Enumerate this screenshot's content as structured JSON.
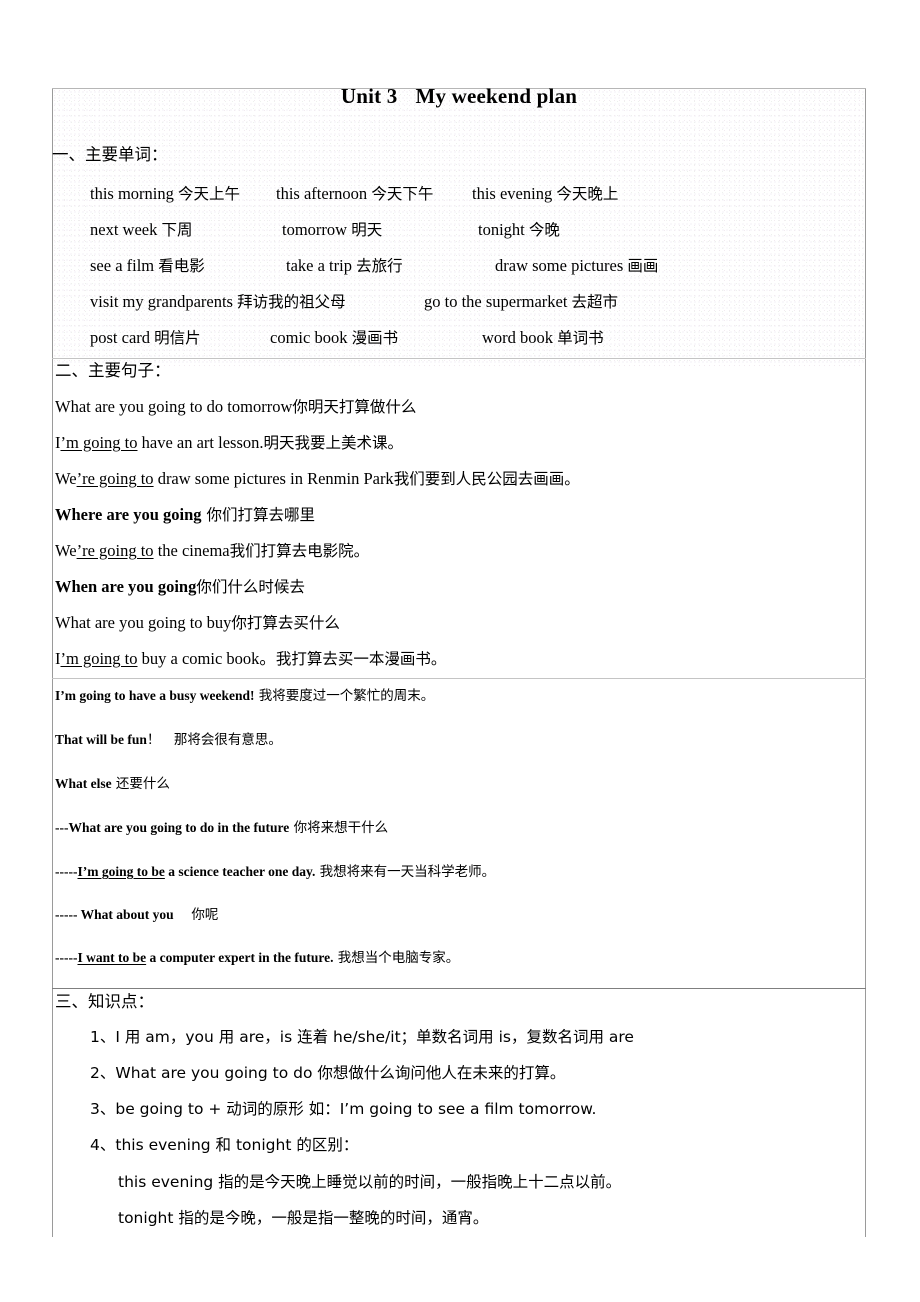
{
  "document": {
    "title_main": "Unit 3",
    "title_sub": "My weekend plan"
  },
  "section1": {
    "heading": "一、主要单词：",
    "rows": [
      [
        {
          "en": "this morning ",
          "cn": "今天上午"
        },
        {
          "en": "this afternoon ",
          "cn": "今天下午"
        },
        {
          "en": "this evening ",
          "cn": "今天晚上"
        }
      ],
      [
        {
          "en": "next week ",
          "cn": "下周"
        },
        {
          "en": "tomorrow ",
          "cn": "明天"
        },
        {
          "en": "tonight ",
          "cn": "今晚"
        }
      ],
      [
        {
          "en": "see a film ",
          "cn": "看电影"
        },
        {
          "en": "take a trip ",
          "cn": "去旅行"
        },
        {
          "en": "draw some pictures ",
          "cn": "画画"
        }
      ],
      [
        {
          "en": "visit my grandparents ",
          "cn": "拜访我的祖父母"
        },
        {
          "en": "go to the supermarket ",
          "cn": "去超市"
        }
      ],
      [
        {
          "en": "post card ",
          "cn": "明信片"
        },
        {
          "en": "comic book ",
          "cn": "漫画书"
        },
        {
          "en": "word book ",
          "cn": "单词书"
        }
      ]
    ]
  },
  "section2": {
    "heading": "二、主要句子：",
    "sentences": [
      {
        "plain": "What are you going to do tomorrow",
        "cn": "你明天打算做什么"
      },
      {
        "pre": "I",
        "underline": "’m going to",
        "post": " have an art lesson.",
        "cn": "明天我要上美术课。"
      },
      {
        "pre": "We",
        "underline": "’re going to",
        "post": " draw some pictures in Renmin Park",
        "cn": "我们要到人民公园去画画。"
      },
      {
        "bold": "Where are you going",
        "cn": " 你们打算去哪里"
      },
      {
        "pre": "We",
        "underline": "’re going to",
        "post": " the cinema",
        "cn": "我们打算去电影院。"
      },
      {
        "bold": "When are you going",
        "cn": "你们什么时候去"
      },
      {
        "plain": "What are you going to buy",
        "cn": "你打算去买什么"
      },
      {
        "pre": "I",
        "underline": "’m going to",
        "post": " buy a comic book。",
        "cn": "我打算去买一本漫画书。"
      }
    ],
    "bold_sentences": [
      {
        "lead": "",
        "bold": "I’m going to have a busy weekend!",
        "cn": " 我将要度过一个繁忙的周末。"
      },
      {
        "lead": "",
        "bold": "That will be fun",
        "bold_tail": "！",
        "cn": "　那将会很有意思。"
      },
      {
        "lead": "",
        "bold": "What else",
        "cn": " 还要什么"
      },
      {
        "lead": "---",
        "bold": "What are you going to do in the future",
        "cn": " 你将来想干什么"
      },
      {
        "lead": "-----",
        "bold_underline": "I’m going to be",
        "bold": " a science teacher one day.",
        "cn": " 我想将来有一天当科学老师。"
      },
      {
        "lead": "----- ",
        "bold": "What about you",
        "cn": "　 你呢"
      },
      {
        "lead": "-----",
        "bold_underline": "I want to be",
        "bold": " a computer expert in the future.",
        "cn": " 我想当个电脑专家。"
      }
    ]
  },
  "section3": {
    "heading": "三、知识点：",
    "points": [
      "1、I 用 am，you 用 are，is 连着 he/she/it；单数名词用 is，复数名词用 are",
      "2、What are you going to do 你想做什么询问他人在未来的打算。",
      "3、be going to + 动词的原形 如：I’m going to see a film tomorrow.",
      "4、this evening 和 tonight 的区别："
    ],
    "sub_points": [
      "this evening 指的是今天晚上睡觉以前的时间，一般指晚上十二点以前。",
      "tonight 指的是今晚，一般是指一整晚的时间，通宵。"
    ]
  }
}
